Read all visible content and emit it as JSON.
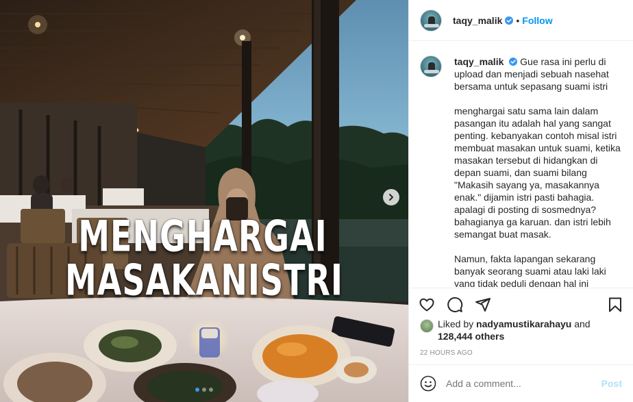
{
  "post": {
    "overlay_line1": "MENGHARGAI",
    "overlay_line2": "MASAKANISTRI",
    "slide_count": 3,
    "active_slide": 0
  },
  "header": {
    "username": "taqy_malik",
    "separator": "•",
    "follow_label": "Follow"
  },
  "caption": {
    "username": "taqy_malik",
    "text": "Gue rasa ini perlu di upload dan menjadi sebuah nasehat bersama untuk sepasang suami istri\n\nmenghargai satu sama lain dalam pasangan itu adalah hal yang sangat penting. kebanyakan contoh misal istri membuat masakan untuk suami, ketika masakan tersebut di hidangkan di depan suami, dan suami bilang \"Makasih sayang ya, masakannya enak.\" dijamin istri pasti bahagia. apalagi di posting di sosmednya? bahagianya ga karuan. dan istri lebih semangat buat masak.\n\nNamun, fakta lapangan sekarang banyak seorang suami atau laki laki yang tidak peduli dengan hal ini"
  },
  "likes": {
    "prefix": "Liked by",
    "liker": "nadyamustikarahayu",
    "and": "and",
    "count": "128,444 others"
  },
  "timestamp": "22 HOURS AGO",
  "comment": {
    "placeholder": "Add a comment...",
    "post_label": "Post"
  },
  "colors": {
    "accent": "#0095f6",
    "post_disabled": "#b2dffc",
    "verified": "#3897f0",
    "muted": "#8e8e8e"
  },
  "icons": [
    "chevron-right-icon",
    "verified-badge-icon",
    "heart-icon",
    "comment-icon",
    "share-icon",
    "bookmark-icon",
    "emoji-icon"
  ]
}
